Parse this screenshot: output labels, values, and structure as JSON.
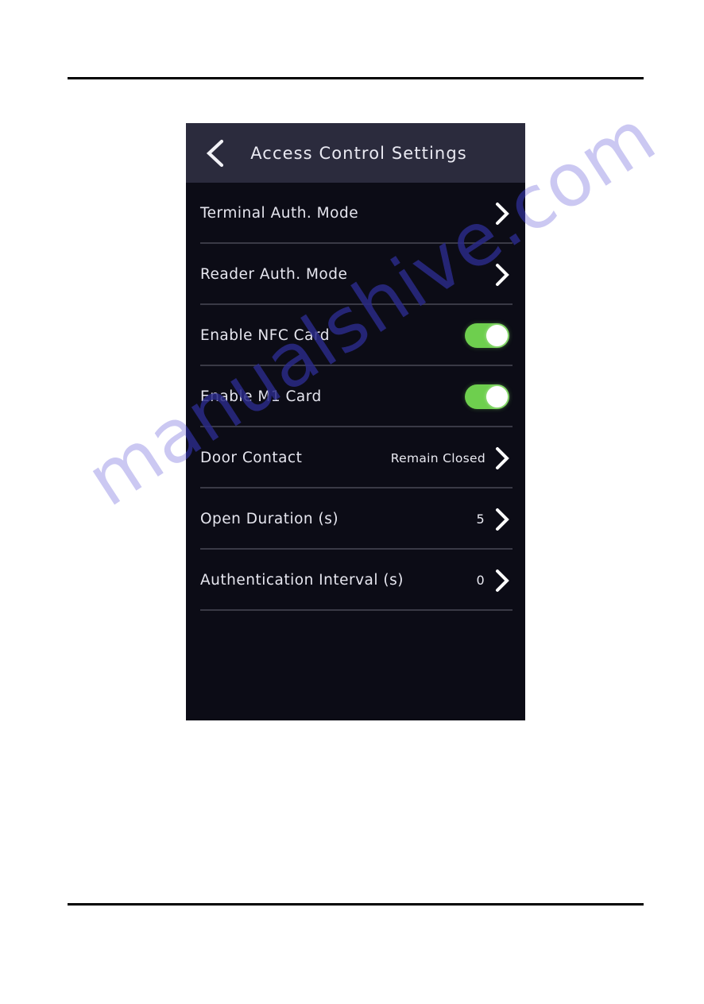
{
  "page": {
    "background": "#ffffff",
    "rule_color": "#000000"
  },
  "watermark": {
    "text": "manualshive.com",
    "outer_color": "#cbc8f2",
    "inner_color": "#2a2a86"
  },
  "device": {
    "panel_bg": "#0c0c16",
    "header_bg": "#2b2b3d",
    "accent_green": "#6ecf4e",
    "header": {
      "title": "Access Control Settings",
      "back_icon": "chevron-left-icon"
    },
    "rows": [
      {
        "label": "Terminal Auth. Mode",
        "type": "navigation",
        "value": "",
        "icon": "chevron-right-icon"
      },
      {
        "label": "Reader Auth. Mode",
        "type": "navigation",
        "value": "",
        "icon": "chevron-right-icon"
      },
      {
        "label": "Enable NFC Card",
        "type": "toggle",
        "value": "on",
        "icon": "toggle-switch-icon"
      },
      {
        "label": "Enable M1 Card",
        "type": "toggle",
        "value": "on",
        "icon": "toggle-switch-icon"
      },
      {
        "label": "Door Contact",
        "type": "navigation",
        "value": "Remain Closed",
        "icon": "chevron-right-icon"
      },
      {
        "label": "Open Duration (s)",
        "type": "navigation",
        "value": "5",
        "icon": "chevron-right-icon"
      },
      {
        "label": "Authentication Interval (s)",
        "type": "navigation",
        "value": "0",
        "icon": "chevron-right-icon"
      }
    ]
  }
}
